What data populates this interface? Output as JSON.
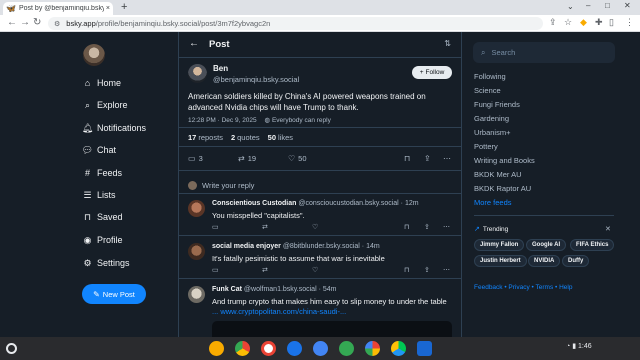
{
  "browser": {
    "tab_title": "Post by @benjaminqiu.bsky.soc",
    "tab_close": "×",
    "new_tab": "+",
    "url_domain": "bsky.app",
    "url_path": "/profile/benjaminqiu.bsky.social/post/3m7f2ybvagc2n"
  },
  "nav": {
    "items": [
      {
        "label": "Home",
        "icon": "home-icon"
      },
      {
        "label": "Explore",
        "icon": "search-icon"
      },
      {
        "label": "Notifications",
        "icon": "bell-icon"
      },
      {
        "label": "Chat",
        "icon": "chat-icon"
      },
      {
        "label": "Feeds",
        "icon": "hash-icon"
      },
      {
        "label": "Lists",
        "icon": "list-icon"
      },
      {
        "label": "Saved",
        "icon": "bookmark-icon"
      },
      {
        "label": "Profile",
        "icon": "user-icon"
      },
      {
        "label": "Settings",
        "icon": "gear-icon"
      }
    ],
    "new_post": "New Post"
  },
  "header": {
    "title": "Post"
  },
  "post": {
    "name": "Ben",
    "handle": "@benjaminqiu.bsky.social",
    "follow_label": "Follow",
    "text": "American soldiers killed by China's AI powered weapons trained on advanced Nvidia chips will have Trump to thank.",
    "timestamp": "12:28 PM · Dec 9, 2025",
    "audience": "Everybody can reply",
    "reposts_count": "17",
    "reposts_label": "reposts",
    "quotes_count": "2",
    "quotes_label": "quotes",
    "likes_count": "50",
    "likes_label": "likes",
    "reply_count": "3",
    "repost_count": "19",
    "like_count": "50"
  },
  "write_reply": "Write your reply",
  "replies": [
    {
      "name": "Conscientious Custodian",
      "handle": "@conscioucustodian.bsky.social · 12m",
      "text": "You misspelled \"capitalists\"."
    },
    {
      "name": "social media enjoyer",
      "handle": "@8bitblunder.bsky.social · 14m",
      "text": "It's fatally pesimistic to assume that war is inevitable"
    },
    {
      "name": "Funk Cat",
      "handle": "@wolfman1.bsky.social · 54m",
      "text": "And trump crypto that makes him easy to slip money to under the table",
      "link": "... www.cryptopolitan.com/china-saudi-..."
    }
  ],
  "right": {
    "search_placeholder": "Search",
    "feeds": [
      "Following",
      "Science",
      "Fungi Friends",
      "Gardening",
      "Urbanism+",
      "Pottery",
      "Writing and Books",
      "BKDK Mer AU",
      "BKDK Raptor AU"
    ],
    "more_feeds": "More feeds",
    "trending_title": "Trending",
    "trending": [
      "Jimmy Fallon",
      "Google AI",
      "FIFA Ethics",
      "Justin Herbert",
      "NVIDIA",
      "Duffy"
    ],
    "footer": "Feedback • Privacy • Terms • Help"
  },
  "shelf": {
    "time": "1:46"
  },
  "colors": {
    "accent": "#1185fe",
    "bg": "#161e27",
    "border": "#2e4052"
  }
}
